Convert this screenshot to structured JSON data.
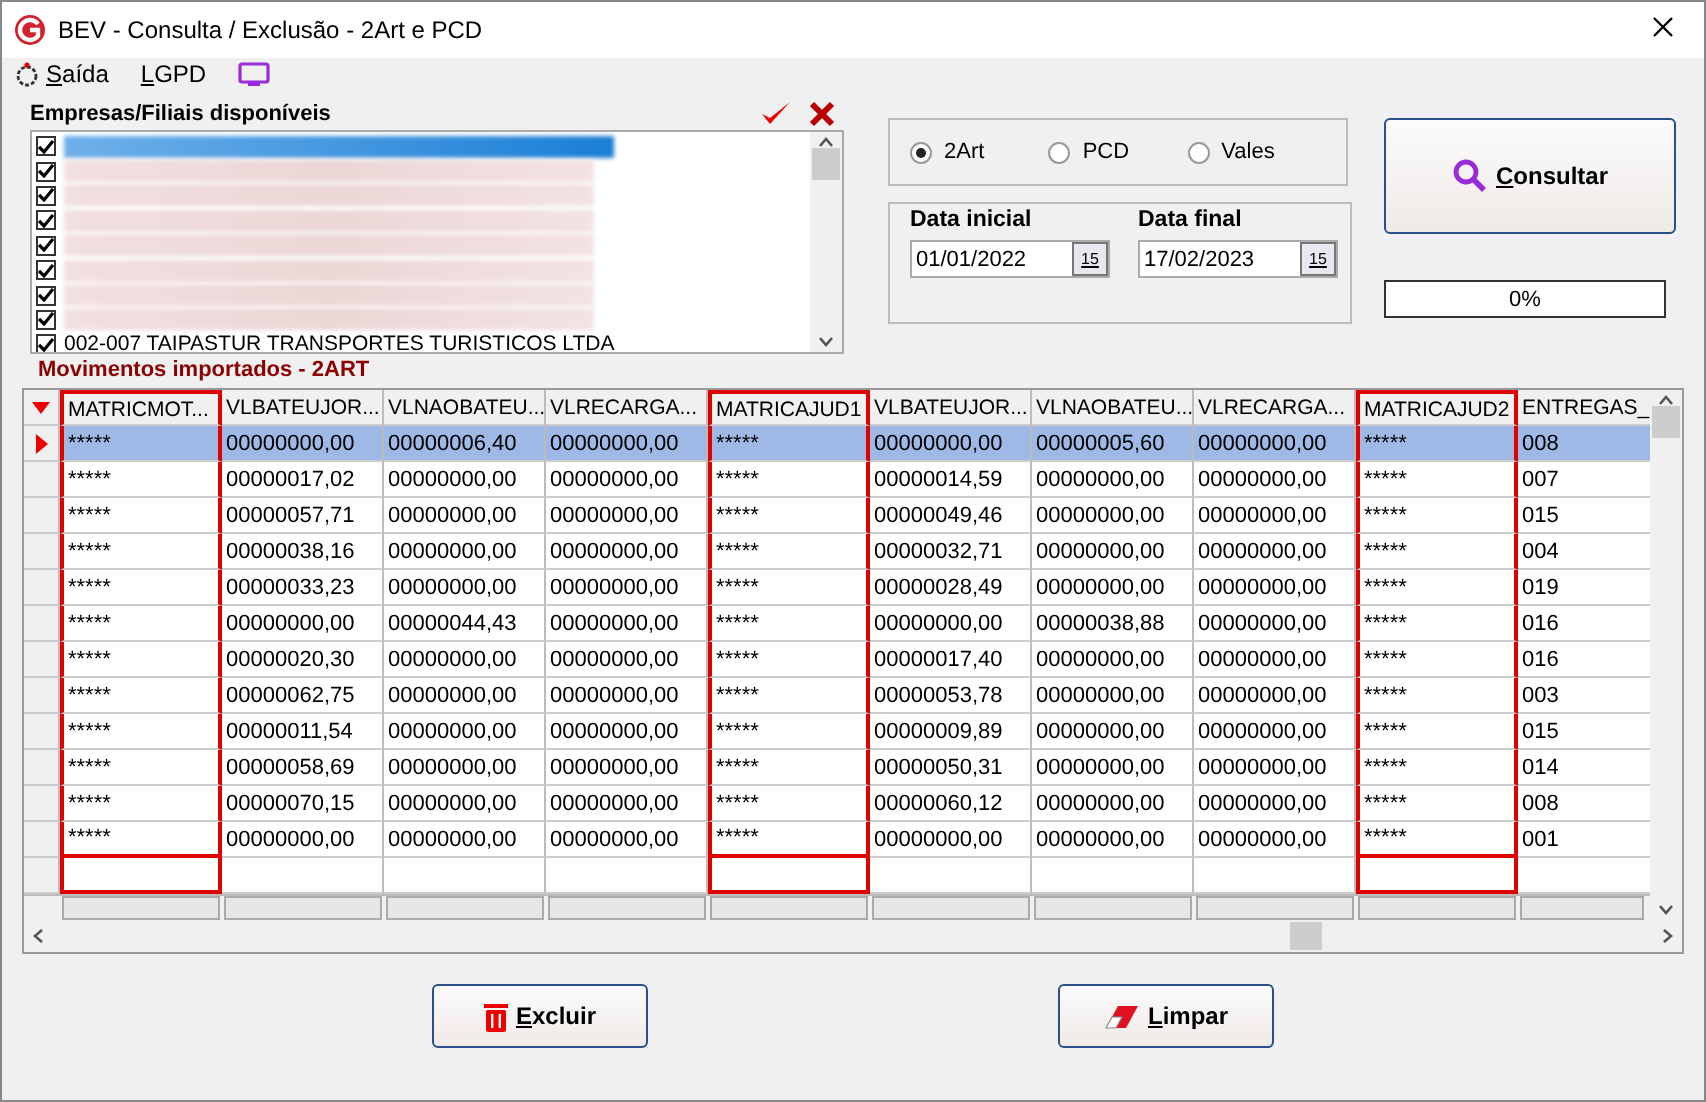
{
  "window": {
    "title": "BEV - Consulta / Exclusão - 2Art e PCD"
  },
  "menu": [
    {
      "kind": "exit",
      "label": "Saída"
    },
    {
      "kind": "lgpd",
      "label": "LGPD"
    }
  ],
  "companies": {
    "title": "Empresas/Filiais disponíveis",
    "items": [
      {
        "checked": true,
        "selected": true,
        "blurred": true
      },
      {
        "checked": true,
        "selected": false,
        "blurred": true
      },
      {
        "checked": true,
        "selected": false,
        "blurred": true
      },
      {
        "checked": true,
        "selected": false,
        "blurred": true
      },
      {
        "checked": true,
        "selected": false,
        "blurred": true
      },
      {
        "checked": true,
        "selected": false,
        "blurred": true
      },
      {
        "checked": true,
        "selected": false,
        "blurred": true
      },
      {
        "checked": true,
        "selected": false,
        "blurred": true
      },
      {
        "checked": true,
        "selected": false,
        "blurred": false,
        "label": "002-007 TAIPASTUR TRANSPORTES TURISTICOS LTDA"
      }
    ]
  },
  "types": [
    {
      "label": "2Art",
      "selected": true
    },
    {
      "label": "PCD",
      "selected": false
    },
    {
      "label": "Vales",
      "selected": false
    }
  ],
  "dates": [
    {
      "label": "Data inicial",
      "value": "01/01/2022",
      "button": "15"
    },
    {
      "label": "Data final",
      "value": "17/02/2023",
      "button": "15"
    }
  ],
  "search_button": "Consultar",
  "progress": {
    "level": 0,
    "reading": "0%"
  },
  "grid": {
    "title": "Movimentos importados - 2ART",
    "columns": [
      {
        "label": "MATRICMOT...",
        "highlighted": true
      },
      {
        "label": "VLBATEUJOR...",
        "highlighted": false
      },
      {
        "label": "VLNAOBATEU...",
        "highlighted": false
      },
      {
        "label": "VLRECARGA...",
        "highlighted": false
      },
      {
        "label": "MATRICAJUD1",
        "highlighted": true
      },
      {
        "label": "VLBATEUJOR...",
        "highlighted": false
      },
      {
        "label": "VLNAOBATEU...",
        "highlighted": false
      },
      {
        "label": "VLRECARGA...",
        "highlighted": false
      },
      {
        "label": "MATRICAJUD2",
        "highlighted": true
      },
      {
        "label": "ENTREGAS_",
        "highlighted": false
      }
    ],
    "rows": [
      {
        "selected": true,
        "cells": [
          "*****",
          "00000000,00",
          "00000006,40",
          "00000000,00",
          "*****",
          "00000000,00",
          "00000005,60",
          "00000000,00",
          "*****",
          "008"
        ]
      },
      {
        "selected": false,
        "cells": [
          "*****",
          "00000017,02",
          "00000000,00",
          "00000000,00",
          "*****",
          "00000014,59",
          "00000000,00",
          "00000000,00",
          "*****",
          "007"
        ]
      },
      {
        "selected": false,
        "cells": [
          "*****",
          "00000057,71",
          "00000000,00",
          "00000000,00",
          "*****",
          "00000049,46",
          "00000000,00",
          "00000000,00",
          "*****",
          "015"
        ]
      },
      {
        "selected": false,
        "cells": [
          "*****",
          "00000038,16",
          "00000000,00",
          "00000000,00",
          "*****",
          "00000032,71",
          "00000000,00",
          "00000000,00",
          "*****",
          "004"
        ]
      },
      {
        "selected": false,
        "cells": [
          "*****",
          "00000033,23",
          "00000000,00",
          "00000000,00",
          "*****",
          "00000028,49",
          "00000000,00",
          "00000000,00",
          "*****",
          "019"
        ]
      },
      {
        "selected": false,
        "cells": [
          "*****",
          "00000000,00",
          "00000044,43",
          "00000000,00",
          "*****",
          "00000000,00",
          "00000038,88",
          "00000000,00",
          "*****",
          "016"
        ]
      },
      {
        "selected": false,
        "cells": [
          "*****",
          "00000020,30",
          "00000000,00",
          "00000000,00",
          "*****",
          "00000017,40",
          "00000000,00",
          "00000000,00",
          "*****",
          "016"
        ]
      },
      {
        "selected": false,
        "cells": [
          "*****",
          "00000062,75",
          "00000000,00",
          "00000000,00",
          "*****",
          "00000053,78",
          "00000000,00",
          "00000000,00",
          "*****",
          "003"
        ]
      },
      {
        "selected": false,
        "cells": [
          "*****",
          "00000011,54",
          "00000000,00",
          "00000000,00",
          "*****",
          "00000009,89",
          "00000000,00",
          "00000000,00",
          "*****",
          "015"
        ]
      },
      {
        "selected": false,
        "cells": [
          "*****",
          "00000058,69",
          "00000000,00",
          "00000000,00",
          "*****",
          "00000050,31",
          "00000000,00",
          "00000000,00",
          "*****",
          "014"
        ]
      },
      {
        "selected": false,
        "cells": [
          "*****",
          "00000070,15",
          "00000000,00",
          "00000000,00",
          "*****",
          "00000060,12",
          "00000000,00",
          "00000000,00",
          "*****",
          "008"
        ]
      },
      {
        "selected": false,
        "cells": [
          "*****",
          "00000000,00",
          "00000000,00",
          "00000000,00",
          "*****",
          "00000000,00",
          "00000000,00",
          "00000000,00",
          "*****",
          "001"
        ]
      }
    ]
  },
  "buttons": [
    {
      "kind": "delete",
      "label": "Excluir"
    },
    {
      "kind": "clear",
      "label": "Limpar"
    }
  ]
}
